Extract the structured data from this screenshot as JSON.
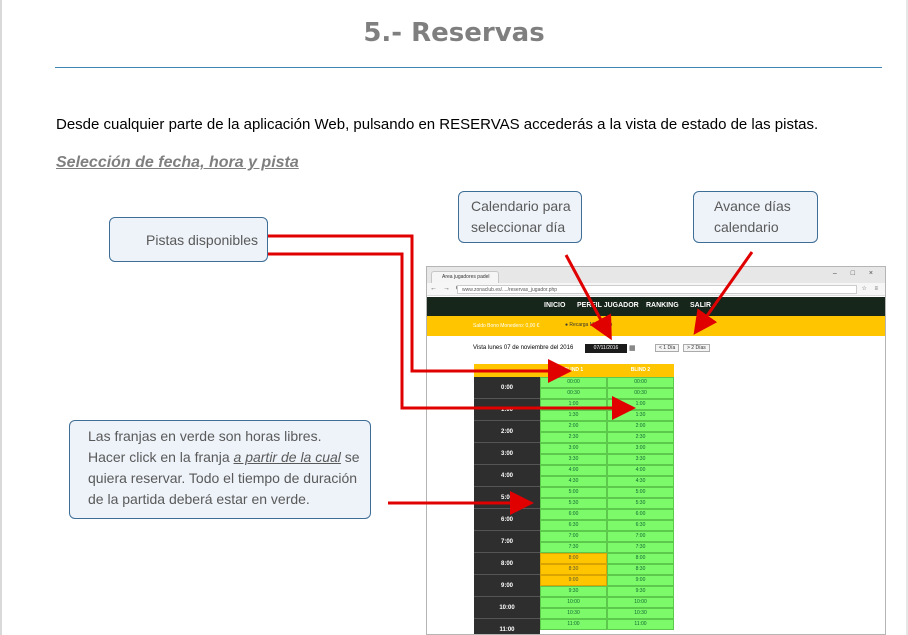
{
  "doc": {
    "title": "5.- Reservas",
    "intro": "Desde cualquier parte de la aplicación Web, pulsando en RESERVAS accederás a la vista de estado de las pistas.",
    "section_heading": "Selección de fecha, hora y pista"
  },
  "callouts": {
    "pistas": "Pistas disponibles",
    "calendario_line1": "Calendario para",
    "calendario_line2": "seleccionar día",
    "avance_line1": "Avance días",
    "avance_line2": "calendario",
    "franjas_part1": "Las franjas en verde son horas libres. Hacer click en la franja ",
    "franjas_emph": "a partir de la cual",
    "franjas_part2": " se quiera reservar. Todo el tiempo de duración de la partida deberá estar en verde."
  },
  "browser": {
    "tab_title": "Area jugadores padel",
    "url": "www.zonaclub.es/..../reservas_jugador.php",
    "nav_icons": "← → C",
    "window_buttons": "–  □  ×",
    "ext_icons": "☆ ≡"
  },
  "site": {
    "menu": [
      "INICIO",
      "PERFIL JUGADOR",
      "RANKING",
      "SALIR"
    ],
    "user_line": "Saldo Bono Monedero: 0,00 €",
    "user_name": "Recarga Monedero",
    "date_label": "Vista lunes 07 de noviembre del 2016",
    "date_value": "07/11/2016",
    "day_buttons": [
      "< 1 Día",
      "> 2 Días"
    ]
  },
  "schedule": {
    "courts": [
      "",
      "BLIND 1",
      "BLIND 2"
    ],
    "hours": [
      "0:00",
      "1:00",
      "2:00",
      "3:00",
      "4:00",
      "5:00",
      "6:00",
      "7:00",
      "8:00",
      "9:00",
      "10:00",
      "11:00"
    ],
    "slots_court1": [
      "00:00",
      "00:30",
      "1:00",
      "1:30",
      "2:00",
      "2:30",
      "3:00",
      "3:30",
      "4:00",
      "4:30",
      "5:00",
      "5:30",
      "6:00",
      "6:30",
      "7:00",
      "7:30",
      "8:00",
      "8:30",
      "9:00",
      "9:30",
      "10:00",
      "10:30",
      "11:00"
    ],
    "slots_court2": [
      "00:00",
      "00:30",
      "1:00",
      "1:30",
      "2:00",
      "2:30",
      "3:00",
      "3:30",
      "4:00",
      "4:30",
      "5:00",
      "5:30",
      "6:00",
      "6:30",
      "7:00",
      "7:30",
      "8:00",
      "8:30",
      "9:00",
      "9:30",
      "10:00",
      "10:30",
      "11:00"
    ],
    "busy_court1": [
      16,
      17,
      18
    ]
  },
  "colors": {
    "free": "#7dfa6a",
    "busy": "#ffc600",
    "arrow": "#e00000",
    "callout_border": "#3e6d96"
  }
}
